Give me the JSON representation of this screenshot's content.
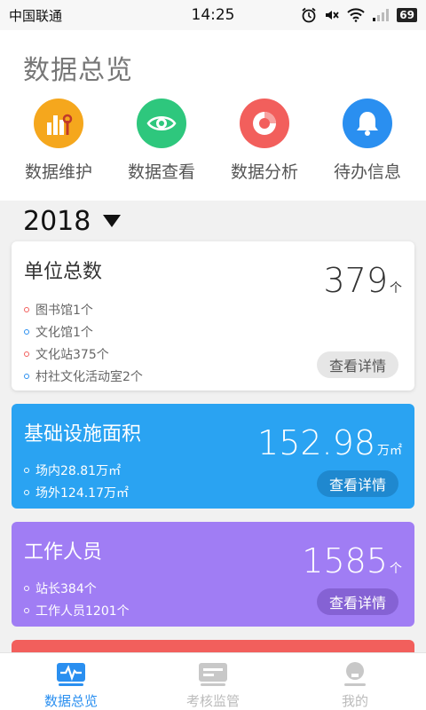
{
  "status_bar": {
    "carrier": "中国联通",
    "time": "14:25",
    "battery": "69"
  },
  "page_title": "数据总览",
  "quick_actions": [
    {
      "label": "数据维护",
      "icon": "bar-chart-wrench-icon",
      "color": "#f5a71d"
    },
    {
      "label": "数据查看",
      "icon": "eye-icon",
      "color": "#2ec77d"
    },
    {
      "label": "数据分析",
      "icon": "pie-chart-icon",
      "color": "#f25f5c"
    },
    {
      "label": "待办信息",
      "icon": "bell-icon",
      "color": "#2a8ff0"
    }
  ],
  "year": "2018",
  "cards": {
    "units": {
      "title": "单位总数",
      "value": "379",
      "unit": "个",
      "items": [
        "图书馆1个",
        "文化馆1个",
        "文化站375个",
        "村社文化活动室2个"
      ],
      "button": "查看详情"
    },
    "area": {
      "title": "基础设施面积",
      "value": "152.98",
      "unit": "万㎡",
      "items": [
        "场内28.81万㎡",
        "场外124.17万㎡"
      ],
      "button": "查看详情"
    },
    "staff": {
      "title": "工作人员",
      "value": "1585",
      "unit": "个",
      "items": [
        "站长384个",
        "工作人员1201个"
      ],
      "button": "查看详情"
    }
  },
  "tabs": [
    {
      "label": "数据总览",
      "icon": "waveform-icon",
      "active": true
    },
    {
      "label": "考核监管",
      "icon": "card-icon",
      "active": false
    },
    {
      "label": "我的",
      "icon": "user-icon",
      "active": false
    }
  ],
  "colors": {
    "blue": "#2aa3f2",
    "purple": "#a07df4",
    "red": "#f25f5c",
    "accent": "#2a8ff0"
  }
}
